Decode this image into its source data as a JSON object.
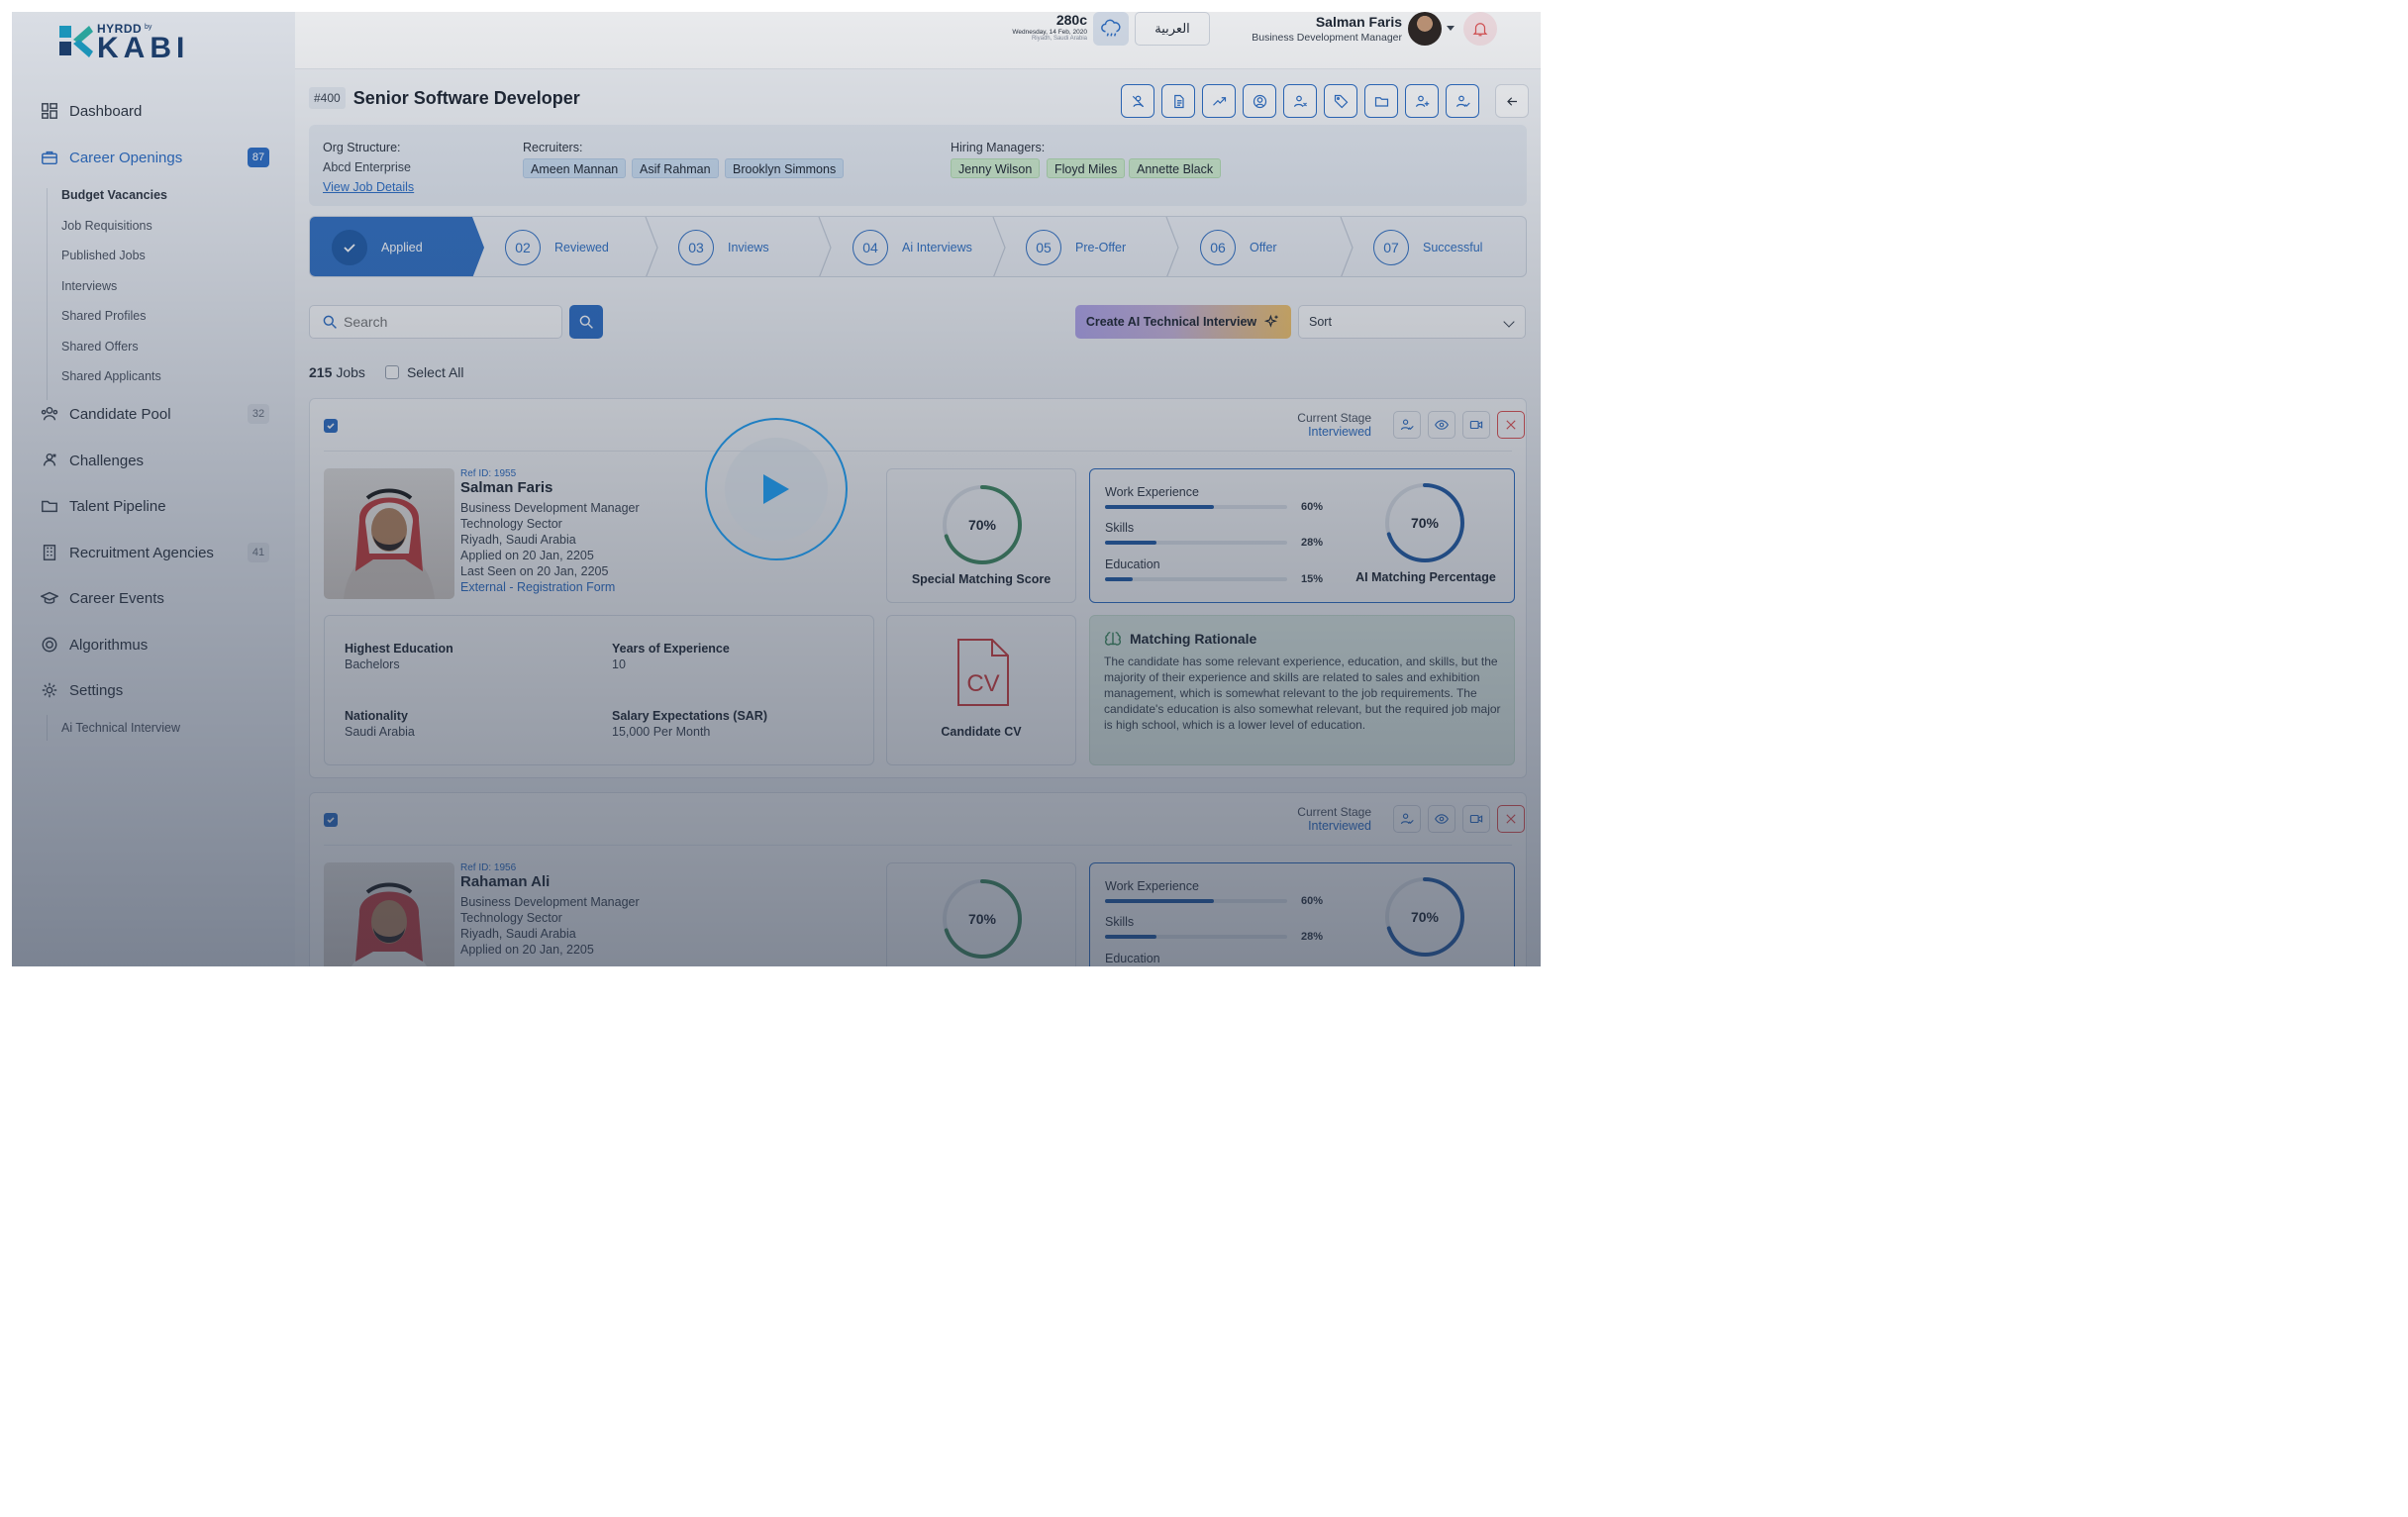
{
  "brand": {
    "small": "HYRDD",
    "by": "by",
    "big": "KABI"
  },
  "sidebar": {
    "items": [
      {
        "label": "Dashboard",
        "icon": "dashboard-icon"
      },
      {
        "label": "Career Openings",
        "icon": "briefcase-icon",
        "badge": "87",
        "active": true
      },
      {
        "label": "Candidate Pool",
        "icon": "users-icon",
        "badge": "32"
      },
      {
        "label": "Challenges",
        "icon": "challenge-icon"
      },
      {
        "label": "Talent Pipeline",
        "icon": "folder-icon"
      },
      {
        "label": "Recruitment Agencies",
        "icon": "building-icon",
        "badge": "41"
      },
      {
        "label": "Career Events",
        "icon": "graduation-icon"
      },
      {
        "label": "Algorithmus",
        "icon": "algorithm-icon"
      },
      {
        "label": "Settings",
        "icon": "gear-icon"
      }
    ],
    "career_sub": [
      "Budget Vacancies",
      "Job Requisitions",
      "Published Jobs",
      "Interviews",
      "Shared Profiles",
      "Shared Offers",
      "Shared Applicants"
    ],
    "settings_sub": [
      "Ai Technical Interview"
    ]
  },
  "header": {
    "temp": "280c",
    "date": "Wednesday, 14 Feb, 2020",
    "location": "Riyadh, Saudi Arabia",
    "language": "العربية",
    "user_name": "Salman Faris",
    "user_role": "Business Development Manager"
  },
  "job": {
    "number": "#400",
    "title": "Senior Software Developer",
    "org_label": "Org Structure:",
    "org_value": "Abcd Enterprise",
    "view_details": "View Job Details",
    "recruiters_label": "Recruiters:",
    "recruiters": [
      "Ameen Mannan",
      "Asif Rahman",
      "Brooklyn Simmons"
    ],
    "managers_label": "Hiring Managers:",
    "managers": [
      "Jenny Wilson",
      "Floyd Miles",
      "Annette Black"
    ]
  },
  "stages": [
    {
      "num": "",
      "label": "Applied"
    },
    {
      "num": "02",
      "label": "Reviewed"
    },
    {
      "num": "03",
      "label": "Inviews"
    },
    {
      "num": "04",
      "label": "Ai Interviews"
    },
    {
      "num": "05",
      "label": "Pre-Offer"
    },
    {
      "num": "06",
      "label": "Offer"
    },
    {
      "num": "07",
      "label": "Successful"
    }
  ],
  "toolbar": {
    "search_placeholder": "Search",
    "ai_button": "Create AI Technical Interview",
    "sort": "Sort",
    "count": "215",
    "count_unit": "Jobs",
    "select_all": "Select All"
  },
  "cards": [
    {
      "stage_label": "Current Stage",
      "stage_value": "Interviewed",
      "ref": "Ref ID: 1955",
      "name": "Salman Faris",
      "lines": [
        "Business Development Manager",
        "Technology Sector",
        "Riyadh, Saudi Arabia",
        "Applied on 20 Jan, 2205",
        "Last Seen on 20 Jan, 2205"
      ],
      "source": "External - Registration Form",
      "special_score": "70%",
      "special_score_value": 0.7,
      "special_label": "Special Matching Score",
      "metrics": [
        {
          "name": "Work Experience",
          "pct": "60%",
          "value": 0.6
        },
        {
          "name": "Skills",
          "pct": "28%",
          "value": 0.28
        },
        {
          "name": "Education",
          "pct": "15%",
          "value": 0.15
        }
      ],
      "ai_pct": "70%",
      "ai_pct_value": 0.7,
      "ai_label": "AI Matching Percentage",
      "details": [
        {
          "k": "Highest Education",
          "v": "Bachelors"
        },
        {
          "k": "Years of Experience",
          "v": "10"
        },
        {
          "k": "Nationality",
          "v": "Saudi Arabia"
        },
        {
          "k": "Salary Expectations (SAR)",
          "v": "15,000 Per Month"
        }
      ],
      "cv_label": "Candidate CV",
      "cv_text": "CV",
      "rationale_title": "Matching Rationale",
      "rationale": "The candidate has some relevant experience, education, and skills, but the majority of their experience and skills are related to sales and exhibition management, which is somewhat relevant to the job requirements. The candidate's education is also somewhat relevant, but the required job major is high school, which is a lower level of education."
    },
    {
      "stage_label": "Current Stage",
      "stage_value": "Interviewed",
      "ref": "Ref ID: 1956",
      "name": "Rahaman Ali",
      "lines": [
        "Business Development Manager",
        "Technology Sector",
        "Riyadh, Saudi Arabia",
        "Applied on 20 Jan, 2205"
      ],
      "special_score": "70%",
      "special_score_value": 0.7,
      "metrics": [
        {
          "name": "Work Experience",
          "pct": "60%",
          "value": 0.6
        },
        {
          "name": "Skills",
          "pct": "28%",
          "value": 0.28
        },
        {
          "name": "Education",
          "pct": "",
          "value": 0.15
        }
      ],
      "ai_pct": "70%",
      "ai_pct_value": 0.7
    }
  ],
  "colors": {
    "accent": "#2a6cc4",
    "danger": "#e35050",
    "ring_green": "#3e8a5e",
    "ring_blue": "#1f5aa6"
  }
}
